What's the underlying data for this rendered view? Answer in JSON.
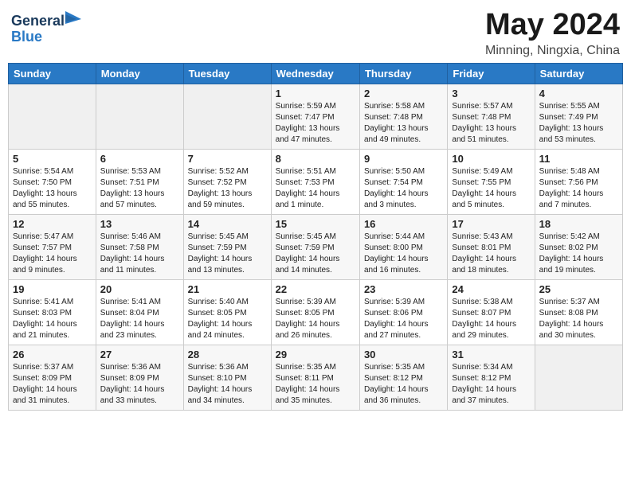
{
  "header": {
    "logo_line1": "General",
    "logo_line2": "Blue",
    "title": "May 2024",
    "location": "Minning, Ningxia, China"
  },
  "days_of_week": [
    "Sunday",
    "Monday",
    "Tuesday",
    "Wednesday",
    "Thursday",
    "Friday",
    "Saturday"
  ],
  "weeks": [
    [
      {
        "day": "",
        "info": ""
      },
      {
        "day": "",
        "info": ""
      },
      {
        "day": "",
        "info": ""
      },
      {
        "day": "1",
        "info": "Sunrise: 5:59 AM\nSunset: 7:47 PM\nDaylight: 13 hours\nand 47 minutes."
      },
      {
        "day": "2",
        "info": "Sunrise: 5:58 AM\nSunset: 7:48 PM\nDaylight: 13 hours\nand 49 minutes."
      },
      {
        "day": "3",
        "info": "Sunrise: 5:57 AM\nSunset: 7:48 PM\nDaylight: 13 hours\nand 51 minutes."
      },
      {
        "day": "4",
        "info": "Sunrise: 5:55 AM\nSunset: 7:49 PM\nDaylight: 13 hours\nand 53 minutes."
      }
    ],
    [
      {
        "day": "5",
        "info": "Sunrise: 5:54 AM\nSunset: 7:50 PM\nDaylight: 13 hours\nand 55 minutes."
      },
      {
        "day": "6",
        "info": "Sunrise: 5:53 AM\nSunset: 7:51 PM\nDaylight: 13 hours\nand 57 minutes."
      },
      {
        "day": "7",
        "info": "Sunrise: 5:52 AM\nSunset: 7:52 PM\nDaylight: 13 hours\nand 59 minutes."
      },
      {
        "day": "8",
        "info": "Sunrise: 5:51 AM\nSunset: 7:53 PM\nDaylight: 14 hours\nand 1 minute."
      },
      {
        "day": "9",
        "info": "Sunrise: 5:50 AM\nSunset: 7:54 PM\nDaylight: 14 hours\nand 3 minutes."
      },
      {
        "day": "10",
        "info": "Sunrise: 5:49 AM\nSunset: 7:55 PM\nDaylight: 14 hours\nand 5 minutes."
      },
      {
        "day": "11",
        "info": "Sunrise: 5:48 AM\nSunset: 7:56 PM\nDaylight: 14 hours\nand 7 minutes."
      }
    ],
    [
      {
        "day": "12",
        "info": "Sunrise: 5:47 AM\nSunset: 7:57 PM\nDaylight: 14 hours\nand 9 minutes."
      },
      {
        "day": "13",
        "info": "Sunrise: 5:46 AM\nSunset: 7:58 PM\nDaylight: 14 hours\nand 11 minutes."
      },
      {
        "day": "14",
        "info": "Sunrise: 5:45 AM\nSunset: 7:59 PM\nDaylight: 14 hours\nand 13 minutes."
      },
      {
        "day": "15",
        "info": "Sunrise: 5:45 AM\nSunset: 7:59 PM\nDaylight: 14 hours\nand 14 minutes."
      },
      {
        "day": "16",
        "info": "Sunrise: 5:44 AM\nSunset: 8:00 PM\nDaylight: 14 hours\nand 16 minutes."
      },
      {
        "day": "17",
        "info": "Sunrise: 5:43 AM\nSunset: 8:01 PM\nDaylight: 14 hours\nand 18 minutes."
      },
      {
        "day": "18",
        "info": "Sunrise: 5:42 AM\nSunset: 8:02 PM\nDaylight: 14 hours\nand 19 minutes."
      }
    ],
    [
      {
        "day": "19",
        "info": "Sunrise: 5:41 AM\nSunset: 8:03 PM\nDaylight: 14 hours\nand 21 minutes."
      },
      {
        "day": "20",
        "info": "Sunrise: 5:41 AM\nSunset: 8:04 PM\nDaylight: 14 hours\nand 23 minutes."
      },
      {
        "day": "21",
        "info": "Sunrise: 5:40 AM\nSunset: 8:05 PM\nDaylight: 14 hours\nand 24 minutes."
      },
      {
        "day": "22",
        "info": "Sunrise: 5:39 AM\nSunset: 8:05 PM\nDaylight: 14 hours\nand 26 minutes."
      },
      {
        "day": "23",
        "info": "Sunrise: 5:39 AM\nSunset: 8:06 PM\nDaylight: 14 hours\nand 27 minutes."
      },
      {
        "day": "24",
        "info": "Sunrise: 5:38 AM\nSunset: 8:07 PM\nDaylight: 14 hours\nand 29 minutes."
      },
      {
        "day": "25",
        "info": "Sunrise: 5:37 AM\nSunset: 8:08 PM\nDaylight: 14 hours\nand 30 minutes."
      }
    ],
    [
      {
        "day": "26",
        "info": "Sunrise: 5:37 AM\nSunset: 8:09 PM\nDaylight: 14 hours\nand 31 minutes."
      },
      {
        "day": "27",
        "info": "Sunrise: 5:36 AM\nSunset: 8:09 PM\nDaylight: 14 hours\nand 33 minutes."
      },
      {
        "day": "28",
        "info": "Sunrise: 5:36 AM\nSunset: 8:10 PM\nDaylight: 14 hours\nand 34 minutes."
      },
      {
        "day": "29",
        "info": "Sunrise: 5:35 AM\nSunset: 8:11 PM\nDaylight: 14 hours\nand 35 minutes."
      },
      {
        "day": "30",
        "info": "Sunrise: 5:35 AM\nSunset: 8:12 PM\nDaylight: 14 hours\nand 36 minutes."
      },
      {
        "day": "31",
        "info": "Sunrise: 5:34 AM\nSunset: 8:12 PM\nDaylight: 14 hours\nand 37 minutes."
      },
      {
        "day": "",
        "info": ""
      }
    ]
  ]
}
